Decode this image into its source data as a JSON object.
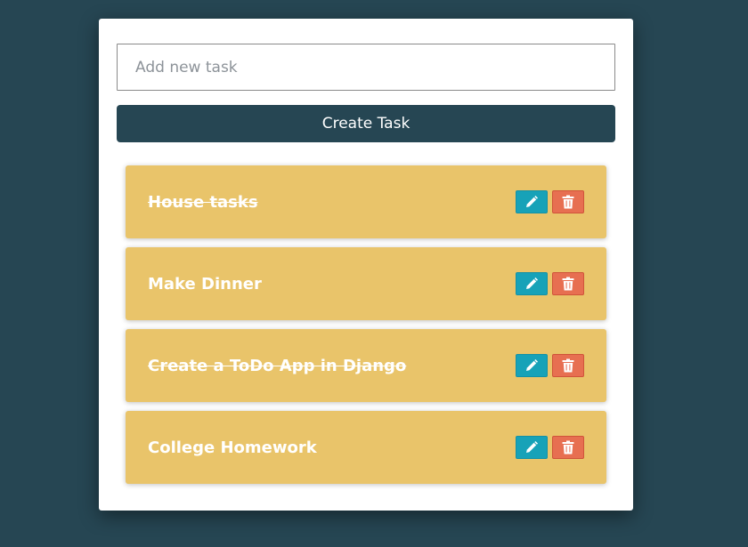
{
  "form": {
    "input_placeholder": "Add new task",
    "input_value": "",
    "create_label": "Create Task"
  },
  "tasks": [
    {
      "title": "House tasks",
      "completed": true
    },
    {
      "title": "Make Dinner",
      "completed": false
    },
    {
      "title": "Create a ToDo App in Django",
      "completed": true
    },
    {
      "title": "College Homework",
      "completed": false
    }
  ],
  "icons": {
    "edit": "pencil-icon",
    "delete": "trash-icon"
  },
  "colors": {
    "background": "#264653",
    "card": "#ffffff",
    "task_background": "#e9c46a",
    "edit_button": "#17a2b8",
    "delete_button": "#e76f51",
    "primary_button": "#264653"
  }
}
